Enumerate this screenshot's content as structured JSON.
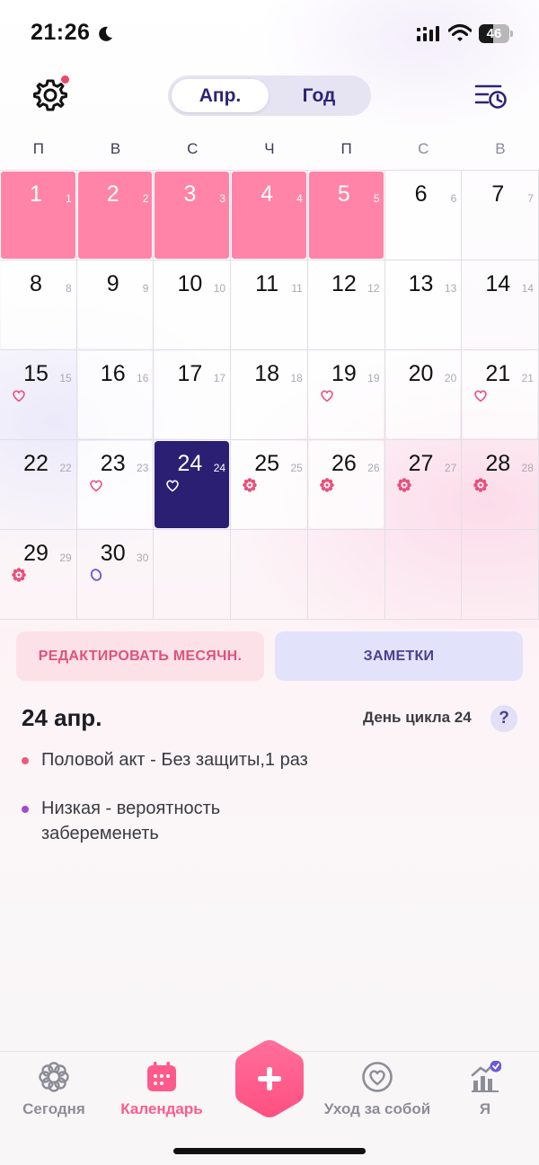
{
  "status_bar": {
    "time": "21:26",
    "battery": "46"
  },
  "header": {
    "segment_month": "Апр.",
    "segment_year": "Год"
  },
  "weekdays": [
    "П",
    "В",
    "С",
    "Ч",
    "П",
    "С",
    "В"
  ],
  "calendar": {
    "days": [
      {
        "day": "1",
        "cycle": "1",
        "state": "period",
        "mark": ""
      },
      {
        "day": "2",
        "cycle": "2",
        "state": "period",
        "mark": ""
      },
      {
        "day": "3",
        "cycle": "3",
        "state": "period",
        "mark": ""
      },
      {
        "day": "4",
        "cycle": "4",
        "state": "period",
        "mark": ""
      },
      {
        "day": "5",
        "cycle": "5",
        "state": "period",
        "mark": ""
      },
      {
        "day": "6",
        "cycle": "6",
        "state": "white",
        "mark": ""
      },
      {
        "day": "7",
        "cycle": "7",
        "state": "",
        "mark": ""
      },
      {
        "day": "8",
        "cycle": "8",
        "state": "white",
        "mark": ""
      },
      {
        "day": "9",
        "cycle": "9",
        "state": "white",
        "mark": ""
      },
      {
        "day": "10",
        "cycle": "10",
        "state": "white",
        "mark": ""
      },
      {
        "day": "11",
        "cycle": "11",
        "state": "white",
        "mark": ""
      },
      {
        "day": "12",
        "cycle": "12",
        "state": "white",
        "mark": ""
      },
      {
        "day": "13",
        "cycle": "13",
        "state": "white",
        "mark": ""
      },
      {
        "day": "14",
        "cycle": "14",
        "state": "",
        "mark": ""
      },
      {
        "day": "15",
        "cycle": "15",
        "state": "",
        "mark": "heart-pink"
      },
      {
        "day": "16",
        "cycle": "16",
        "state": "white",
        "mark": ""
      },
      {
        "day": "17",
        "cycle": "17",
        "state": "white",
        "mark": ""
      },
      {
        "day": "18",
        "cycle": "18",
        "state": "white",
        "mark": ""
      },
      {
        "day": "19",
        "cycle": "19",
        "state": "white",
        "mark": "heart-pink"
      },
      {
        "day": "20",
        "cycle": "20",
        "state": "white",
        "mark": ""
      },
      {
        "day": "21",
        "cycle": "21",
        "state": "white",
        "mark": "heart-pink"
      },
      {
        "day": "22",
        "cycle": "22",
        "state": "",
        "mark": ""
      },
      {
        "day": "23",
        "cycle": "23",
        "state": "white",
        "mark": "heart-pink"
      },
      {
        "day": "24",
        "cycle": "24",
        "state": "selected",
        "mark": "heart-white"
      },
      {
        "day": "25",
        "cycle": "25",
        "state": "white",
        "mark": "flower"
      },
      {
        "day": "26",
        "cycle": "26",
        "state": "white",
        "mark": "flower"
      },
      {
        "day": "27",
        "cycle": "27",
        "state": "",
        "mark": "flower"
      },
      {
        "day": "28",
        "cycle": "28",
        "state": "",
        "mark": "flower"
      },
      {
        "day": "29",
        "cycle": "29",
        "state": "",
        "mark": "flower"
      },
      {
        "day": "30",
        "cycle": "30",
        "state": "",
        "mark": "oval"
      }
    ]
  },
  "actions": {
    "edit_period": "РЕДАКТИРОВАТЬ МЕСЯЧН.",
    "notes": "ЗАМЕТКИ"
  },
  "detail": {
    "date": "24 апр.",
    "cycle_day": "День цикла 24",
    "help": "?",
    "notes": [
      {
        "text": "Половой акт - Без защиты,1 раз",
        "color": "#f0587f"
      },
      {
        "text": "Низкая - вероятность забеременеть",
        "color": "#a24ad0"
      }
    ]
  },
  "tabbar": {
    "today": "Сегодня",
    "calendar": "Календарь",
    "self_care": "Уход за собой",
    "me": "Я"
  },
  "colors": {
    "period": "#ff84a8",
    "selected": "#2b1f73",
    "accent": "#ff5a8b",
    "brand_dark": "#2d2474"
  },
  "icons": {
    "settings": "gear-icon",
    "history": "cycle-history-icon",
    "add": "plus-icon"
  }
}
